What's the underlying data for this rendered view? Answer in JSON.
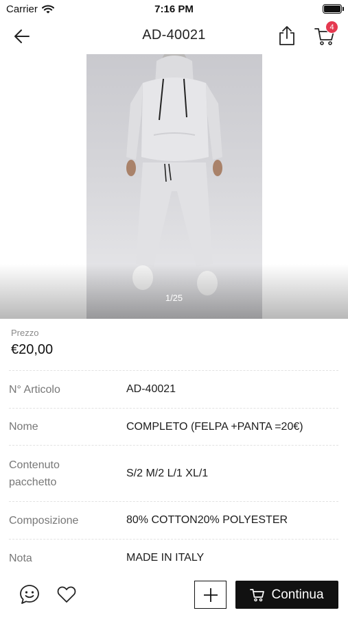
{
  "status_bar": {
    "carrier": "Carrier",
    "time": "7:16 PM"
  },
  "nav": {
    "title": "AD-40021",
    "cart_count": "4"
  },
  "gallery": {
    "counter": "1/25"
  },
  "price": {
    "label": "Prezzo",
    "value": "€20,00"
  },
  "details": [
    {
      "label": "N° Articolo",
      "value": "AD-40021"
    },
    {
      "label": "Nome",
      "value": "COMPLETO (FELPA +PANTA =20€)"
    },
    {
      "label": "Contenuto pacchetto",
      "value": "S/2 M/2 L/1 XL/1"
    },
    {
      "label": "Composizione",
      "value": "80% COTTON20% POLYESTER"
    },
    {
      "label": "Nota",
      "value": "MADE IN ITALY"
    }
  ],
  "bottom_bar": {
    "continue_label": "Continua"
  },
  "colors": {
    "badge": "#e53950",
    "primary": "#111111"
  },
  "icons": [
    "wifi-icon",
    "battery-icon",
    "back-arrow-icon",
    "share-icon",
    "cart-icon",
    "chat-icon",
    "heart-icon",
    "plus-icon"
  ]
}
